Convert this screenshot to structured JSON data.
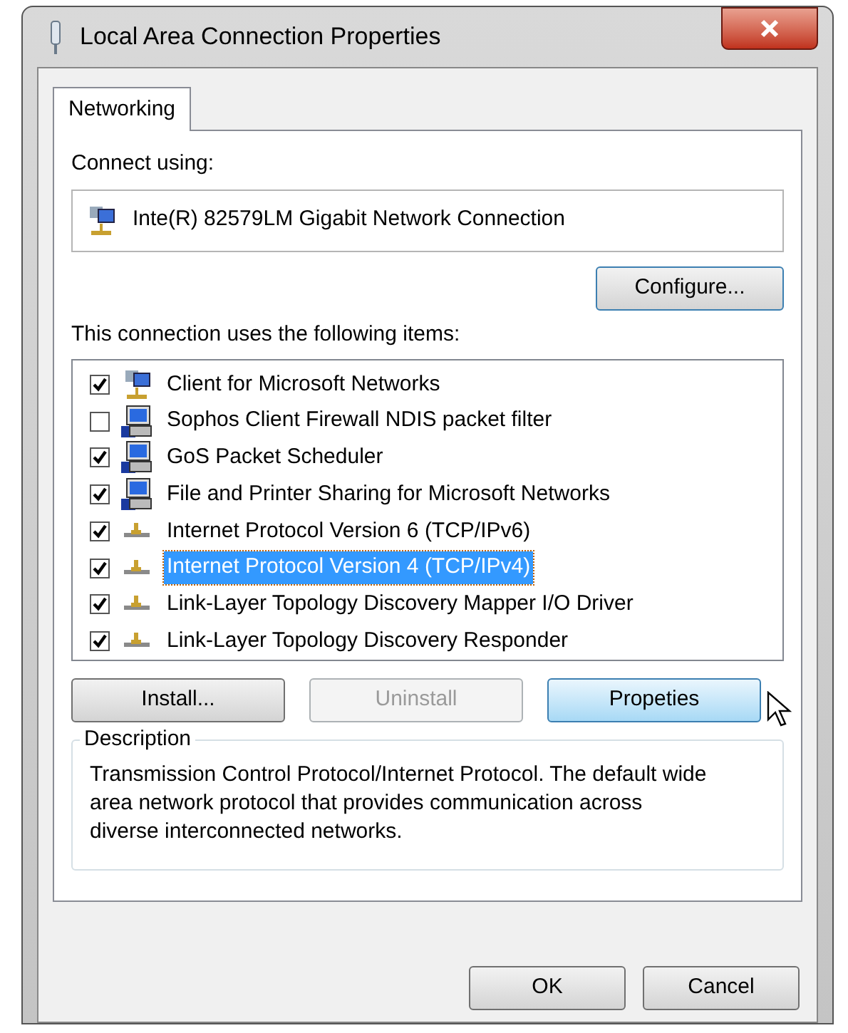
{
  "window": {
    "title": "Local Area Connection Properties"
  },
  "tabs": [
    {
      "label": "Networking",
      "selected": true
    }
  ],
  "connect_using": {
    "label": "Connect using:",
    "adapter": "Inte(R) 82579LM Gigabit Network Connection",
    "configure_button": "Configure..."
  },
  "items_label": "This connection uses the following items:",
  "items": [
    {
      "kind": "client",
      "label": "Client for Microsoft Networks",
      "checked": true,
      "selected": false
    },
    {
      "kind": "service",
      "label": "Sophos Client Firewall NDIS packet filter",
      "checked": false,
      "selected": false
    },
    {
      "kind": "service",
      "label": "GoS Packet Scheduler",
      "checked": true,
      "selected": false
    },
    {
      "kind": "service",
      "label": "File and Printer Sharing for Microsoft Networks",
      "checked": true,
      "selected": false
    },
    {
      "kind": "protocol",
      "label": "Internet Protocol Version 6 (TCP/IPv6)",
      "checked": true,
      "selected": false
    },
    {
      "kind": "protocol",
      "label": "Internet Protocol Version 4 (TCP/IPv4)",
      "checked": true,
      "selected": true
    },
    {
      "kind": "protocol",
      "label": "Link-Layer Topology Discovery Mapper I/O Driver",
      "checked": true,
      "selected": false
    },
    {
      "kind": "protocol",
      "label": "Link-Layer Topology Discovery Responder",
      "checked": true,
      "selected": false
    }
  ],
  "item_buttons": [
    {
      "label": "Install...",
      "disabled": false,
      "hovered": false
    },
    {
      "label": "Uninstall",
      "disabled": true,
      "hovered": false
    },
    {
      "label": "Propeties",
      "disabled": false,
      "hovered": true
    }
  ],
  "description": {
    "title": "Description",
    "text": "Transmission Control Protocol/Internet Protocol. The default wide area network protocol that provides communication across diverse interconnected networks."
  },
  "dialog_buttons": [
    {
      "label": "OK"
    },
    {
      "label": "Cancel"
    }
  ]
}
